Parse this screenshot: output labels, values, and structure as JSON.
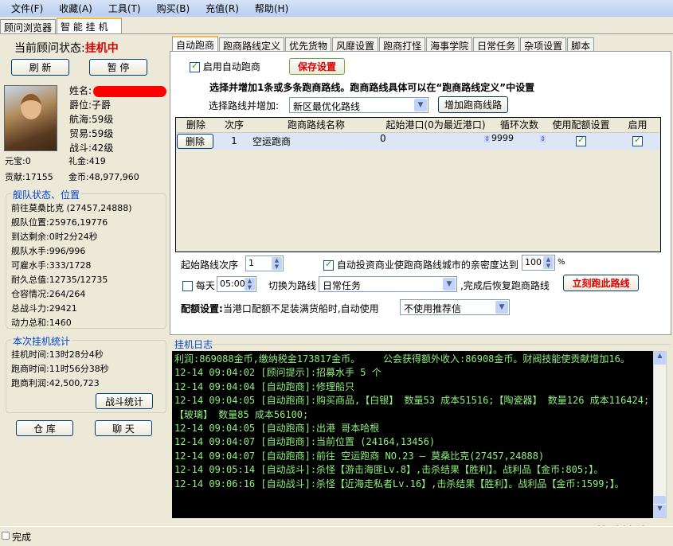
{
  "menu": [
    "文件(F)",
    "收藏(A)",
    "工具(T)",
    "购买(B)",
    "充值(R)",
    "帮助(H)"
  ],
  "main_tabs": [
    "顾问浏览器",
    "智 能 挂 机"
  ],
  "left": {
    "status_label": "当前顾问状态:",
    "status_value": "挂机中",
    "refresh": "刷 新",
    "pause": "暂 停",
    "profile": {
      "name_label": "姓名:",
      "title": "爵位:子爵",
      "navigation": "航海:59级",
      "trade": "贸易:59级",
      "combat": "战斗:42级",
      "yuanbao": "元宝:0",
      "lijin": "礼金:419",
      "contribution": "贡献:17155",
      "gold": "金币:48,977,960"
    },
    "fleet_title": "舰队状态、位置",
    "fleet": [
      "前往莫桑比克 (27457,24888)",
      "舰队位置:25976,19776",
      "到达剩余:0时2分24秒",
      "舰队水手:996/996",
      "可雇水手:333/1728",
      "耐久总值:12735/12735",
      "仓容情况:264/264",
      "总战斗力:29421",
      "动力总和:1460"
    ],
    "stats_title": "本次挂机统计",
    "stats": [
      "挂机时间:13时28分4秒",
      "跑商时间:11时56分38秒",
      "跑商利润:42,500,723"
    ],
    "battle_stats": "战斗统计",
    "warehouse": "仓 库",
    "chat": "聊 天"
  },
  "right": {
    "tabs": [
      "自动跑商",
      "跑商路线定义",
      "优先货物",
      "风靡设置",
      "跑商打怪",
      "海事学院",
      "日常任务",
      "杂项设置",
      "脚本"
    ],
    "enable_label": "启用自动跑商",
    "save": "保存设置",
    "instruction": "选择并增加1条或多条跑商路线。跑商路线具体可以在“跑商路线定义”中设置",
    "select_label": "选择路线并增加:",
    "select_value": "新区最优化路线",
    "add_route": "增加跑商线路",
    "columns": [
      "删除",
      "次序",
      "跑商路线名称",
      "起始港口(0为最近港口)",
      "循环次数",
      "使用配额设置",
      "启用"
    ],
    "rows": [
      {
        "delete": "删除",
        "order": "1",
        "name": "空运跑商",
        "port": "0",
        "loops": "9999",
        "quota": true,
        "enabled": true
      }
    ],
    "start_order_label": "起始路线次序",
    "start_order": "1",
    "invest_label": "自动投资商业使跑商路线城市的亲密度达到",
    "invest_value": "100",
    "percent": "%",
    "daily_label": "每天",
    "daily_time": "05:00",
    "switch_label": "切换为路线",
    "switch_value": "日常任务",
    "restore_label": ",完成后恢复跑商路线",
    "run_now": "立刻跑此路线",
    "quota_bold": "配额设置:",
    "quota_label": "当港口配额不足装满货船时,自动使用",
    "quota_value": "不使用推荐信"
  },
  "log_title": "挂机日志",
  "log": [
    "利润:869088金币,缴纳税金173817金币。    公会获得额外收入:86908金币。财阀技能使贡献增加16。",
    "12-14 09:04:02 [顾问提示]:招募水手 5 个",
    "12-14 09:04:04 [自动跑商]:修理船只",
    "12-14 09:04:05 [自动跑商]:购买商品,【白银】 数量53 成本51516;【陶瓷器】 数量126 成本116424;【玻璃】 数量85 成本56100;",
    "12-14 09:04:05 [自动跑商]:出港 哥本哈根",
    "12-14 09:04:07 [自动跑商]:当前位置 (24164,13456)",
    "12-14 09:04:07 [自动跑商]:前往 空运跑商 NO.23 — 莫桑比克(27457,24888)",
    "12-14 09:05:14 [自动战斗]:杀怪【游击海匪Lv.8】,击杀结果【胜利】。战利品【金币:805;】。",
    "12-14 09:06:16 [自动战斗]:杀怪【近海走私者Lv.16】,击杀结果【胜利】。战利品【金币:1599;】。"
  ],
  "statusbar": "完成",
  "watermark": "Moyuzone.org 夢遊論壇"
}
